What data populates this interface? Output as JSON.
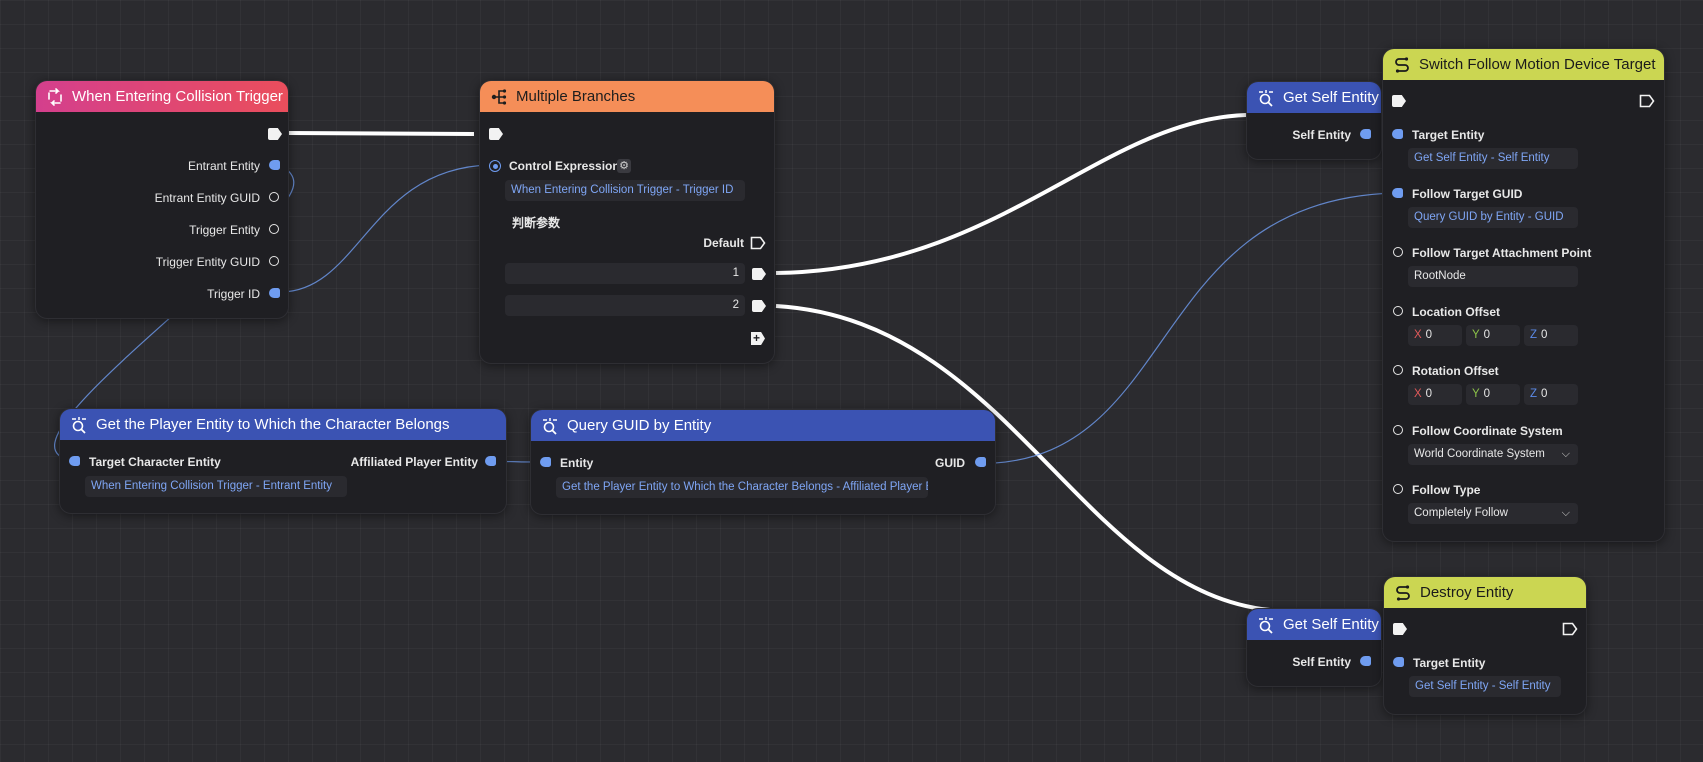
{
  "nodes": {
    "collision_trigger": {
      "title": "When Entering Collision Trigger",
      "outputs": [
        "Entrant Entity",
        "Entrant Entity GUID",
        "Trigger Entity",
        "Trigger Entity GUID",
        "Trigger ID"
      ]
    },
    "multiple_branches": {
      "title": "Multiple Branches",
      "control_label": "Control Expression",
      "control_value": "When Entering Collision Trigger - Trigger ID",
      "judgement_label": "判断参数",
      "default_label": "Default",
      "branch_values": [
        "1",
        "2"
      ]
    },
    "get_player_entity": {
      "title": "Get the Player Entity to Which the Character Belongs",
      "input_label": "Target Character Entity",
      "output_label": "Affiliated Player Entity",
      "input_value": "When Entering Collision Trigger - Entrant Entity"
    },
    "query_guid": {
      "title": "Query GUID by Entity",
      "input_label": "Entity",
      "output_label": "GUID",
      "input_value": "Get the Player Entity to Which the Character Belongs - Affiliated Player Entity"
    },
    "get_self_entity_1": {
      "title": "Get Self Entity",
      "output_label": "Self Entity"
    },
    "get_self_entity_2": {
      "title": "Get Self Entity",
      "output_label": "Self Entity"
    },
    "switch_follow": {
      "title": "Switch Follow Motion Device Target",
      "target_entity_label": "Target Entity",
      "target_entity_value": "Get Self Entity - Self Entity",
      "follow_guid_label": "Follow Target GUID",
      "follow_guid_value": "Query GUID by Entity - GUID",
      "attach_point_label": "Follow Target Attachment Point",
      "attach_point_value": "RootNode",
      "location_offset_label": "Location Offset",
      "location": {
        "x_axis": "X",
        "x": "0",
        "y_axis": "Y",
        "y": "0",
        "z_axis": "Z",
        "z": "0"
      },
      "rotation_offset_label": "Rotation Offset",
      "rotation": {
        "x_axis": "X",
        "x": "0",
        "y_axis": "Y",
        "y": "0",
        "z_axis": "Z",
        "z": "0"
      },
      "coord_system_label": "Follow Coordinate System",
      "coord_system_value": "World Coordinate System",
      "follow_type_label": "Follow Type",
      "follow_type_value": "Completely Follow"
    },
    "destroy_entity": {
      "title": "Destroy Entity",
      "target_entity_label": "Target Entity",
      "target_entity_value": "Get Self Entity - Self Entity"
    }
  },
  "colors": {
    "canvas": "#2b2b2f",
    "node_body": "#1f1f23",
    "event_header": "#e0466f",
    "control_header": "#f58e58",
    "query_header": "#3b53b3",
    "action_header": "#cbd652",
    "data_pin": "#6f9cf0",
    "exec_wire": "#ffffff"
  }
}
